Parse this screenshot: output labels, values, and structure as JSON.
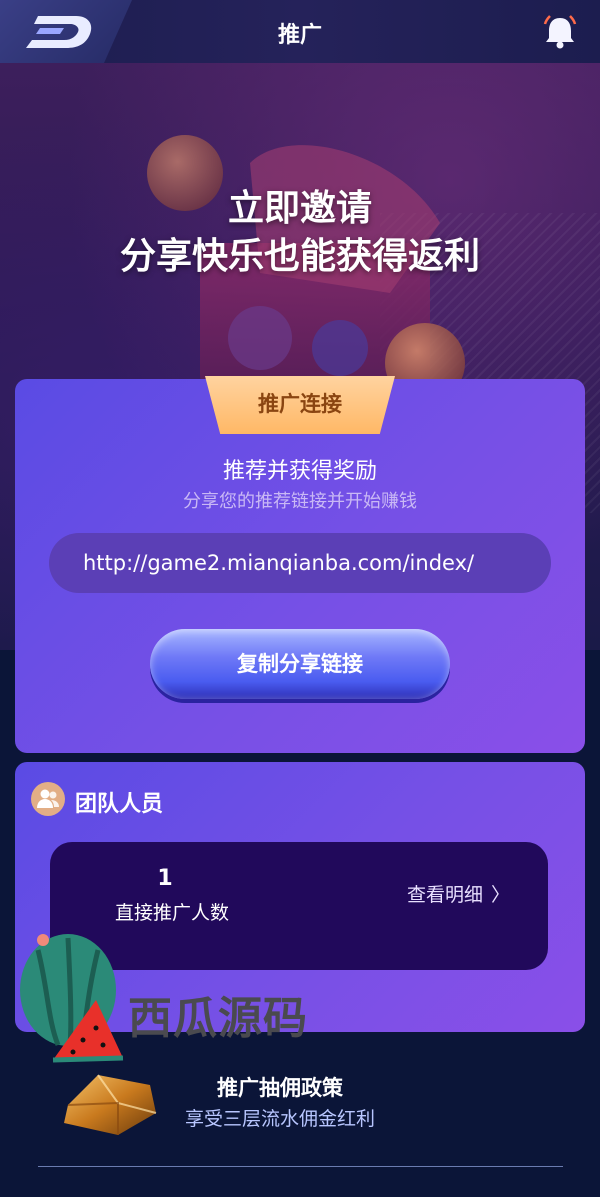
{
  "header": {
    "title": "推广",
    "logo_icon": "brand-logo-icon",
    "bell_icon": "bell-icon"
  },
  "hero": {
    "title_line1": "立即邀请",
    "title_line2": "分享快乐也能获得返利"
  },
  "promo": {
    "tab_label": "推广连接",
    "heading": "推荐并获得奖励",
    "subheading": "分享您的推荐链接并开始赚钱",
    "link_value": "http://game2.mianqianba.com/index/",
    "copy_button_label": "复制分享链接"
  },
  "team": {
    "title": "团队人员",
    "direct_count": "1",
    "direct_count_label": "直接推广人数",
    "view_detail_label": "查看明细"
  },
  "watermark": {
    "text": "西瓜源码"
  },
  "policy": {
    "title": "推广抽佣政策",
    "subtitle": "享受三层流水佣金红利"
  },
  "colors": {
    "page_bg": "#0b1538",
    "card_gradient_start": "#5a4be4",
    "card_gradient_end": "#8a4fe8",
    "tab_gold": "#ffb866",
    "team_box": "#21095b"
  }
}
